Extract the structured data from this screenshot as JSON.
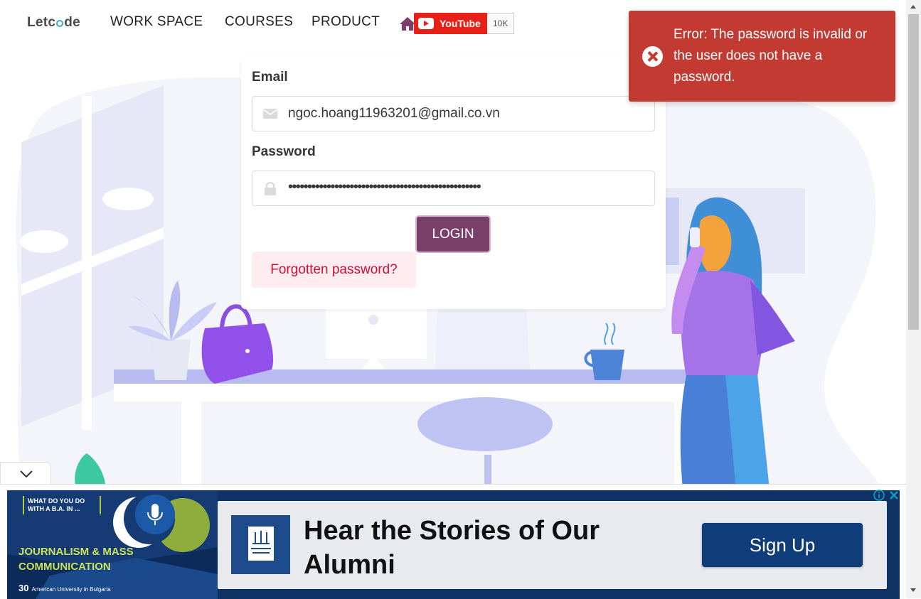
{
  "navbar": {
    "logo_text_left": "Let",
    "logo_text_right": "de",
    "items": [
      "WORK SPACE",
      "COURSES",
      "PRODUCT"
    ],
    "youtube_label": "YouTube",
    "youtube_count": "10K"
  },
  "login": {
    "email_label": "Email",
    "email_value": "ngoc.hoang11963201@gmail.co.vn",
    "password_label": "Password",
    "password_value": "••••••••••••••••••••••••••••••••••••••••••••••••••",
    "login_button": "LOGIN",
    "forgot_link": "Forgotten password?"
  },
  "toast": {
    "message": "Error: The password is invalid or the user does not have a password."
  },
  "ad": {
    "tagline": "WHAT DO YOU DO WITH A B.A. IN ...",
    "program": "JOURNALISM & MASS COMMUNICATION",
    "anniversary": "30",
    "university": "American University in Bulgaria",
    "headline": "Hear the Stories of Our Alumni",
    "cta": "Sign Up"
  },
  "colors": {
    "brand_purple": "#7b3f6b",
    "toast_red": "#c23a32",
    "forgot_text": "#cc0f35",
    "ad_navy": "#0f3d7a"
  }
}
